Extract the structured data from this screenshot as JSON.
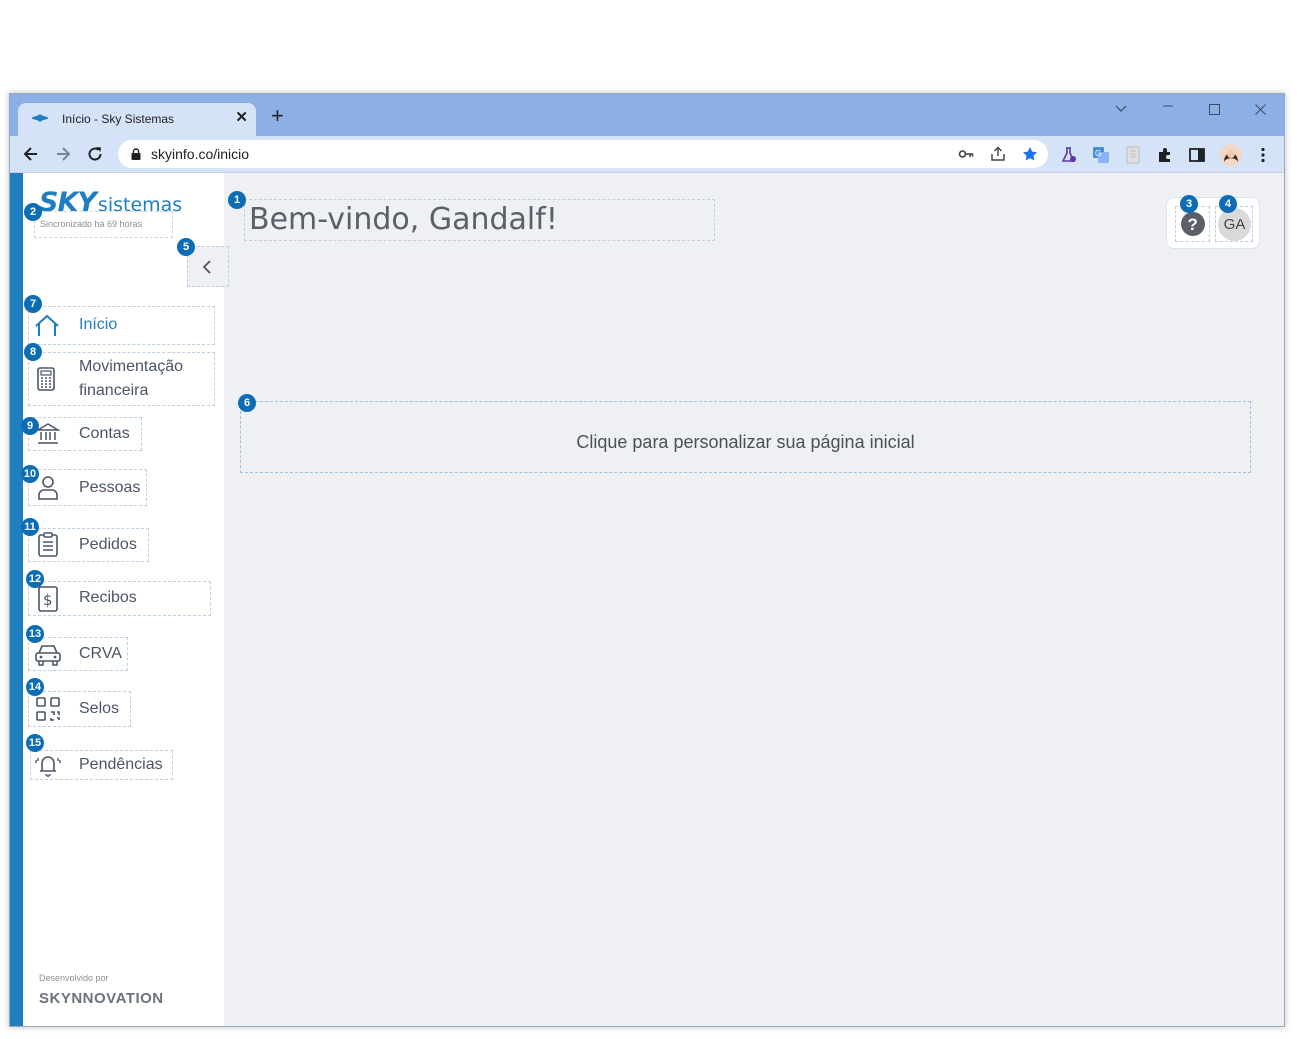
{
  "browser": {
    "tab_title": "Início - Sky Sistemas",
    "url": "skyinfo.co/inicio"
  },
  "sidebar": {
    "logo_sky": "SKY",
    "logo_sistemas": "sistemas",
    "sync_status": "Sincronizado há 69 horas",
    "items": [
      {
        "label": "Início",
        "badge": "7",
        "icon": "home-icon"
      },
      {
        "label": "Movimentação financeira",
        "badge": "8",
        "icon": "calculator-icon"
      },
      {
        "label": "Contas",
        "badge": "9",
        "icon": "bank-icon"
      },
      {
        "label": "Pessoas",
        "badge": "10",
        "icon": "person-icon"
      },
      {
        "label": "Pedidos",
        "badge": "11",
        "icon": "clipboard-icon"
      },
      {
        "label": "Recibos",
        "badge": "12",
        "icon": "receipt-dollar-icon"
      },
      {
        "label": "CRVA",
        "badge": "13",
        "icon": "car-icon"
      },
      {
        "label": "Selos",
        "badge": "14",
        "icon": "qr-code-icon"
      },
      {
        "label": "Pendências",
        "badge": "15",
        "icon": "bell-ringing-icon"
      }
    ],
    "footer_label": "Desenvolvido por",
    "footer_logo": "SKYNNOVATION"
  },
  "main": {
    "welcome": "Bem-vindo, Gandalf!",
    "avatar_initials": "GA",
    "customize_text": "Clique para personalizar sua página inicial"
  },
  "badges": {
    "welcome": "1",
    "sync": "2",
    "help": "3",
    "avatar": "4",
    "collapse": "5",
    "customize": "6"
  },
  "colors": {
    "brand": "#1e7ec0",
    "badge": "#0d6db4",
    "chrome_tabbar": "#8cafe6"
  }
}
